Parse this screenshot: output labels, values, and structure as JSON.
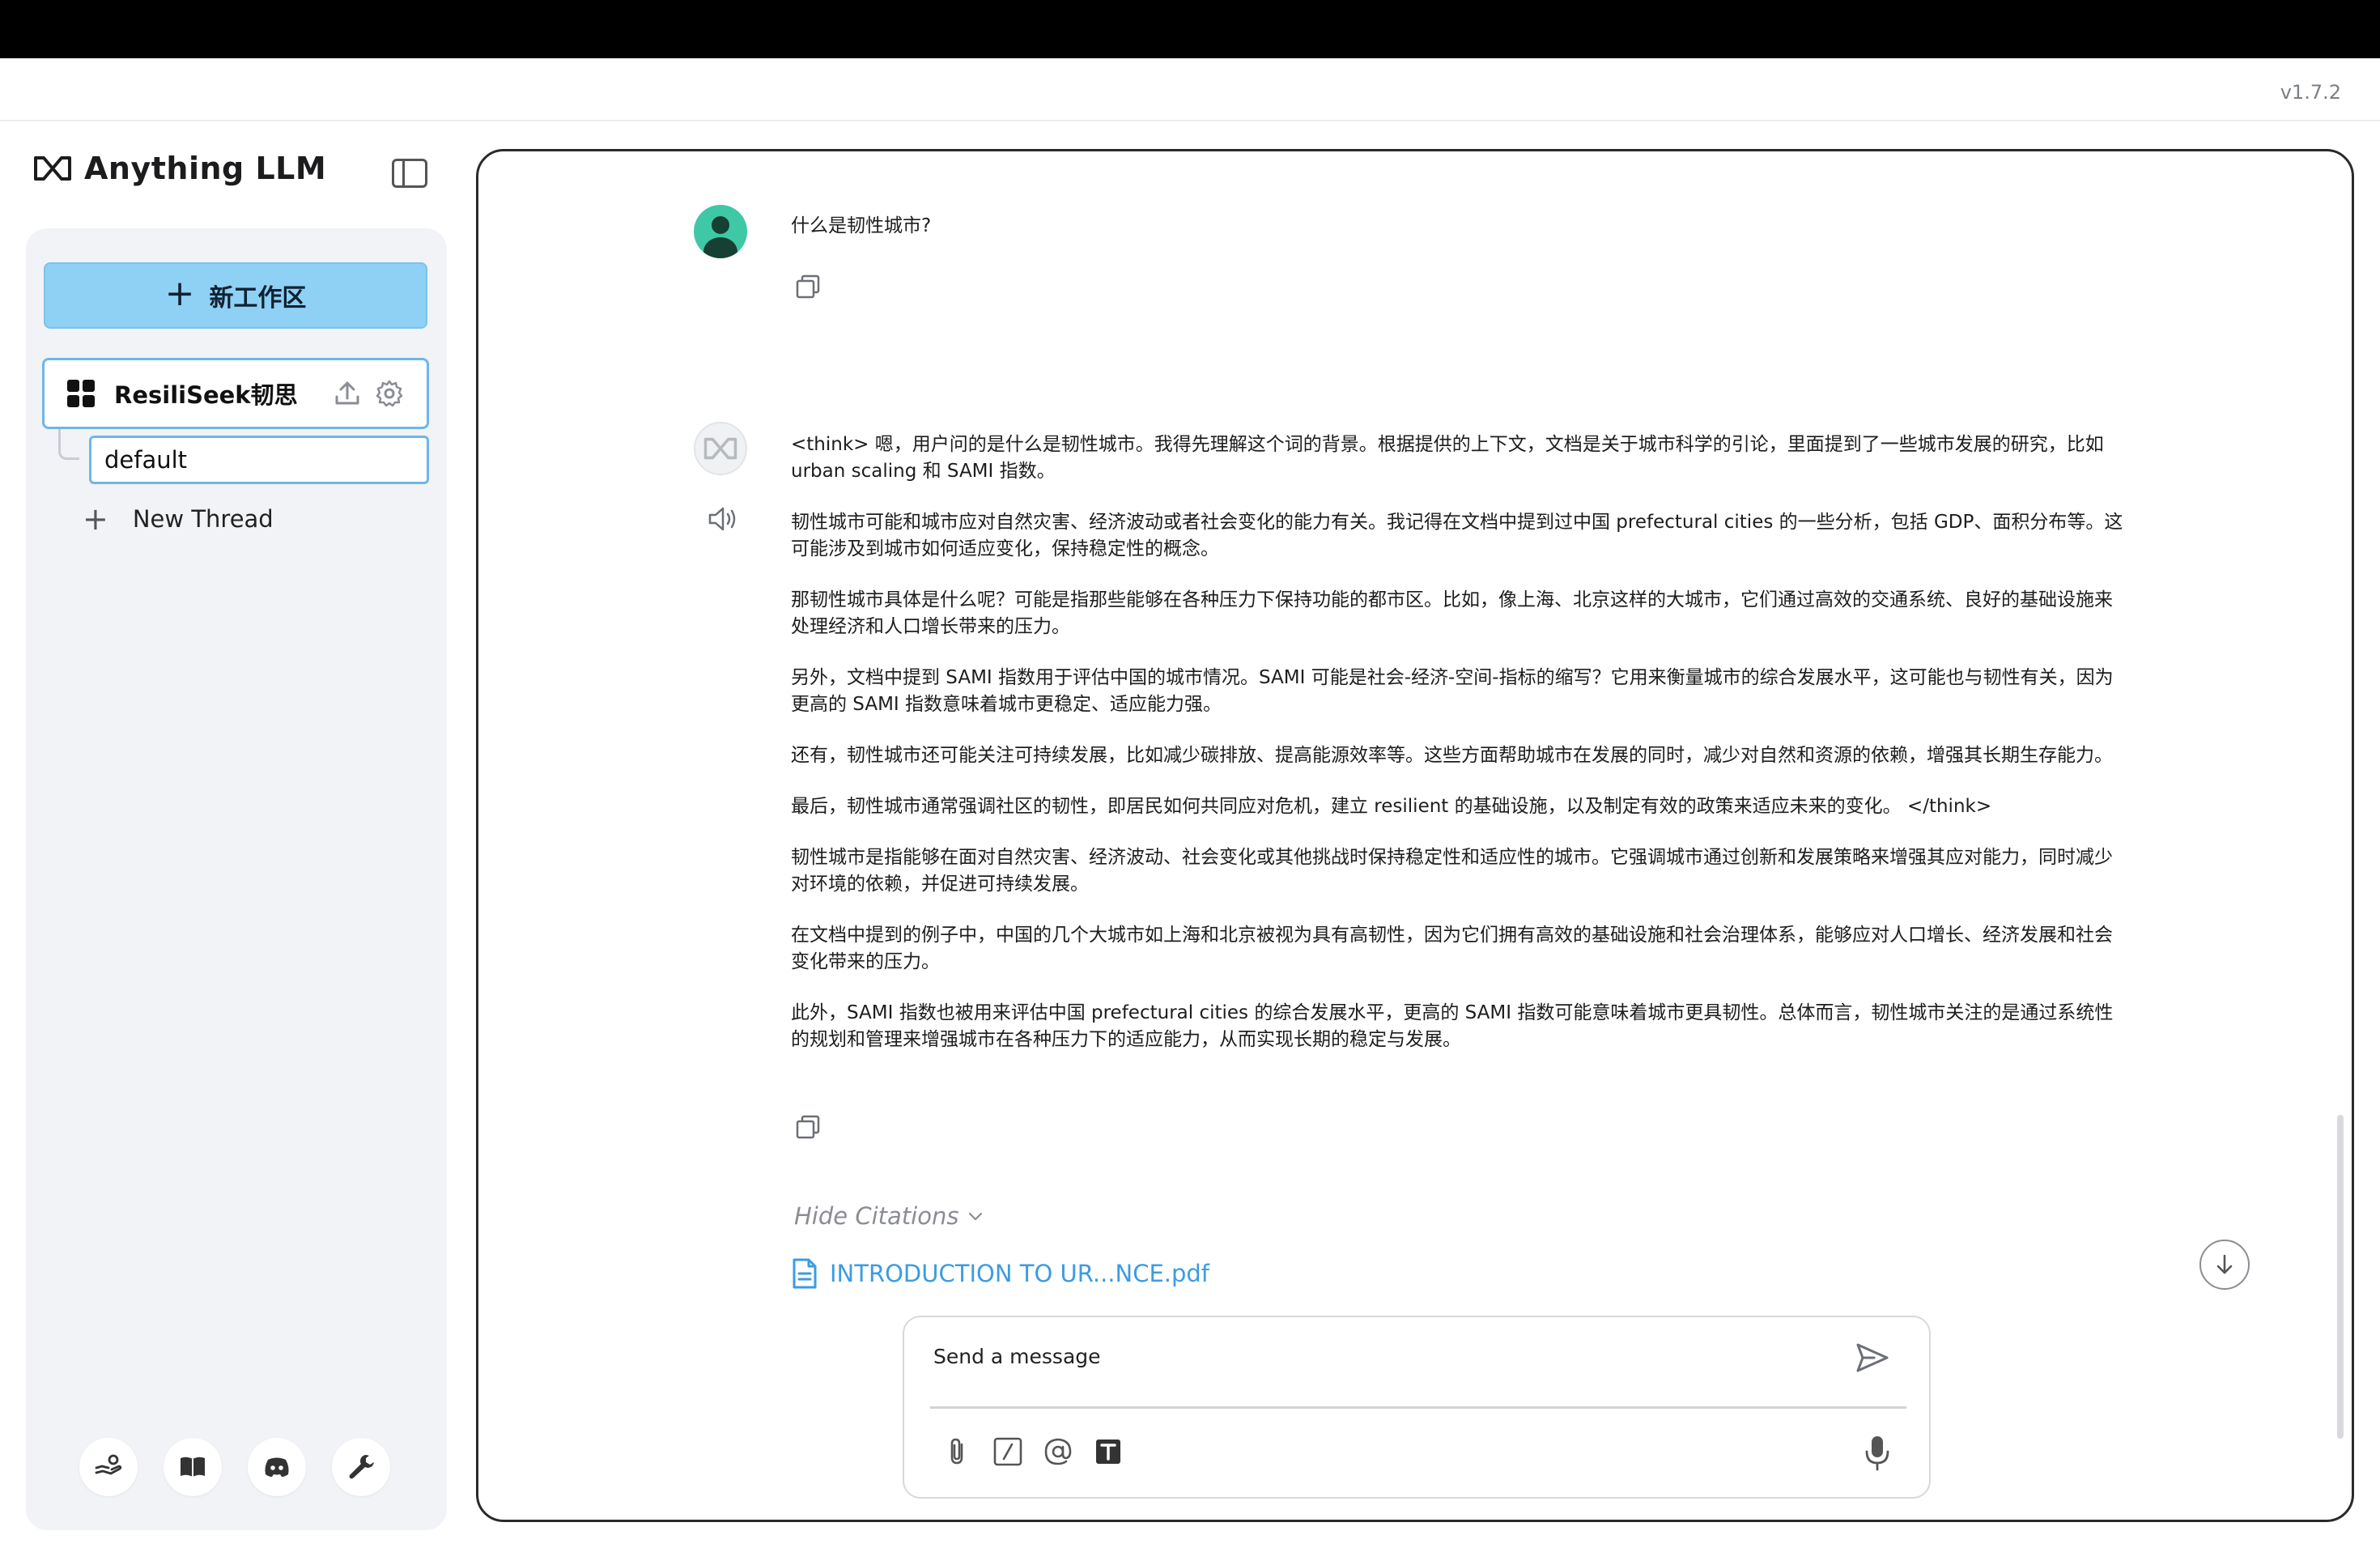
{
  "app": {
    "name": "Anything LLM",
    "version": "v1.7.2"
  },
  "sidebar": {
    "new_workspace_label": "新工作区",
    "workspace": {
      "name": "ResiliSeek韧思"
    },
    "threads": [
      {
        "label": "default",
        "active": true
      }
    ],
    "new_thread_label": "New Thread",
    "footer_icons": [
      "community-hub-icon",
      "docs-book-icon",
      "discord-icon",
      "settings-wrench-icon"
    ]
  },
  "chat": {
    "user_message": "什么是韧性城市?",
    "assistant_paragraphs": [
      "<think> 嗯，用户问的是什么是韧性城市。我得先理解这个词的背景。根据提供的上下文，文档是关于城市科学的引论，里面提到了一些城市发展的研究，比如 urban scaling 和 SAMI 指数。",
      "韧性城市可能和城市应对自然灾害、经济波动或者社会变化的能力有关。我记得在文档中提到过中国 prefectural cities 的一些分析，包括 GDP、面积分布等。这可能涉及到城市如何适应变化，保持稳定性的概念。",
      "那韧性城市具体是什么呢？可能是指那些能够在各种压力下保持功能的都市区。比如，像上海、北京这样的大城市，它们通过高效的交通系统、良好的基础设施来处理经济和人口增长带来的压力。",
      "另外，文档中提到 SAMI 指数用于评估中国的城市情况。SAMI 可能是社会-经济-空间-指标的缩写？它用来衡量城市的综合发展水平，这可能也与韧性有关，因为更高的 SAMI 指数意味着城市更稳定、适应能力强。",
      "还有，韧性城市还可能关注可持续发展，比如减少碳排放、提高能源效率等。这些方面帮助城市在发展的同时，减少对自然和资源的依赖，增强其长期生存能力。",
      "最后，韧性城市通常强调社区的韧性，即居民如何共同应对危机，建立 resilient 的基础设施，以及制定有效的政策来适应未来的变化。 </think>",
      "韧性城市是指能够在面对自然灾害、经济波动、社会变化或其他挑战时保持稳定性和适应性的城市。它强调城市通过创新和发展策略来增强其应对能力，同时减少对环境的依赖，并促进可持续发展。",
      "在文档中提到的例子中，中国的几个大城市如上海和北京被视为具有高韧性，因为它们拥有高效的基础设施和社会治理体系，能够应对人口增长、经济发展和社会变化带来的压力。",
      "此外，SAMI 指数也被用来评估中国 prefectural cities 的综合发展水平，更高的 SAMI 指数可能意味着城市更具韧性。总体而言，韧性城市关注的是通过系统性的规划和管理来增强城市在各种压力下的适应能力，从而实现长期的稳定与发展。"
    ],
    "hide_citations_label": "Hide Citations",
    "citations": [
      {
        "label": "INTRODUCTION TO UR...NCE.pdf"
      }
    ]
  },
  "composer": {
    "placeholder": "Send a message"
  },
  "colors": {
    "accent": "#8fd0f5",
    "active_border": "#6fb6e8",
    "citation_link": "#3d9be2",
    "user_avatar": "#3fc8a6"
  }
}
